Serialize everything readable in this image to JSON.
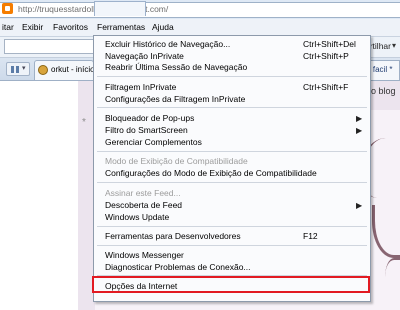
{
  "address_bar": {
    "url": "http://truquesstardoll-facil.blogspot.com/"
  },
  "menubar": {
    "items": [
      {
        "label": "itar"
      },
      {
        "label": "Exibir"
      },
      {
        "label": "Favoritos"
      },
      {
        "label": "Ferramentas"
      },
      {
        "label": "Ajuda"
      }
    ]
  },
  "toolbar": {
    "share_label": "artilhar",
    "chevron": "▾"
  },
  "tabs": {
    "left_label": "orkut - início",
    "right_label": "- facil *"
  },
  "page": {
    "partial_text": "o blog",
    "star": "*"
  },
  "tools_menu": {
    "items": [
      {
        "label": "Excluir Histórico de Navegação...",
        "shortcut": "Ctrl+Shift+Del"
      },
      {
        "label": "Navegação InPrivate",
        "shortcut": "Ctrl+Shift+P"
      },
      {
        "label": "Reabrir Última Sessão de Navegação",
        "shortcut": ""
      },
      {
        "label": "Filtragem InPrivate",
        "shortcut": "Ctrl+Shift+F"
      },
      {
        "label": "Configurações da Filtragem InPrivate",
        "shortcut": ""
      },
      {
        "label": "Bloqueador de Pop-ups",
        "submenu": true
      },
      {
        "label": "Filtro do SmartScreen",
        "submenu": true
      },
      {
        "label": "Gerenciar Complementos",
        "submenu": false
      },
      {
        "label": "Modo de Exibição de Compatibilidade",
        "disabled": true
      },
      {
        "label": "Configurações do Modo de Exibição de Compatibilidade"
      },
      {
        "label": "Assinar este Feed...",
        "disabled": true
      },
      {
        "label": "Descoberta de Feed",
        "submenu": true
      },
      {
        "label": "Windows Update"
      },
      {
        "label": "Ferramentas para Desenvolvedores",
        "shortcut": "F12"
      },
      {
        "label": "Windows Messenger"
      },
      {
        "label": "Diagnosticar Problemas de Conexão..."
      },
      {
        "label": "Opções da Internet"
      }
    ],
    "submenu_arrow": "▶"
  },
  "colors": {
    "highlight_border": "#e21a22",
    "menu_background": "#fafbfd"
  }
}
